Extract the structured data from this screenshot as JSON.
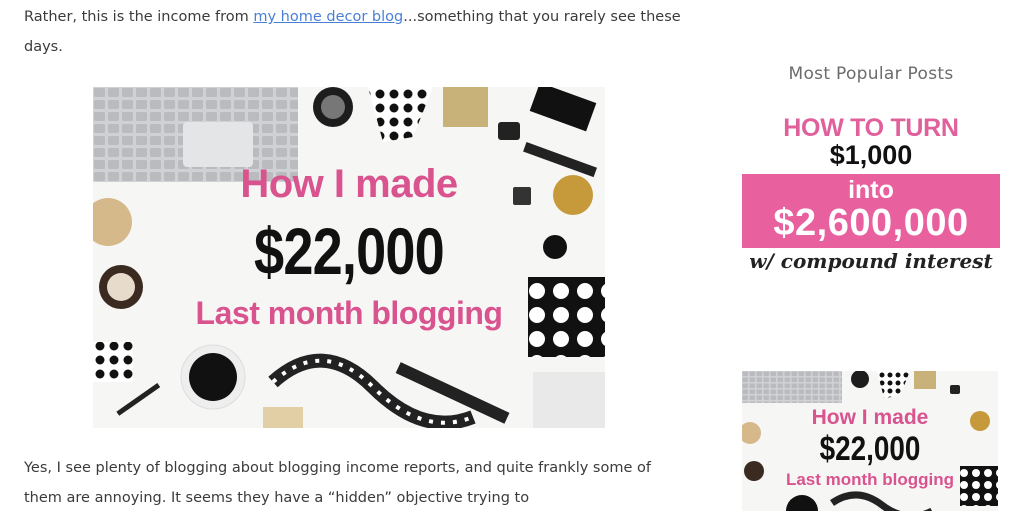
{
  "article": {
    "p1_before_link": "Rather, this is the income from ",
    "p1_link": "my home decor blog",
    "p1_after_link": "...something that you rarely see these days.",
    "featured_image": {
      "line1": "How I made",
      "line2": "$22,000",
      "line3": "Last month blogging"
    },
    "p2": "Yes, I see plenty of blogging about blogging income reports, and quite frankly some of them are annoying.  It seems they have a “hidden” objective trying to"
  },
  "sidebar": {
    "title": "Most Popular Posts",
    "post1": {
      "line1": "HOW TO TURN",
      "line2": "$1,000",
      "line3": "into",
      "line4": "$2,600,000",
      "line5": "w/ compound interest"
    },
    "post2": {
      "line1": "How I made",
      "line2": "$22,000",
      "line3": "Last month blogging"
    }
  },
  "colors": {
    "link": "#4a7fd6",
    "accent_pink": "#e8609e",
    "text": "#3b3b3b"
  }
}
